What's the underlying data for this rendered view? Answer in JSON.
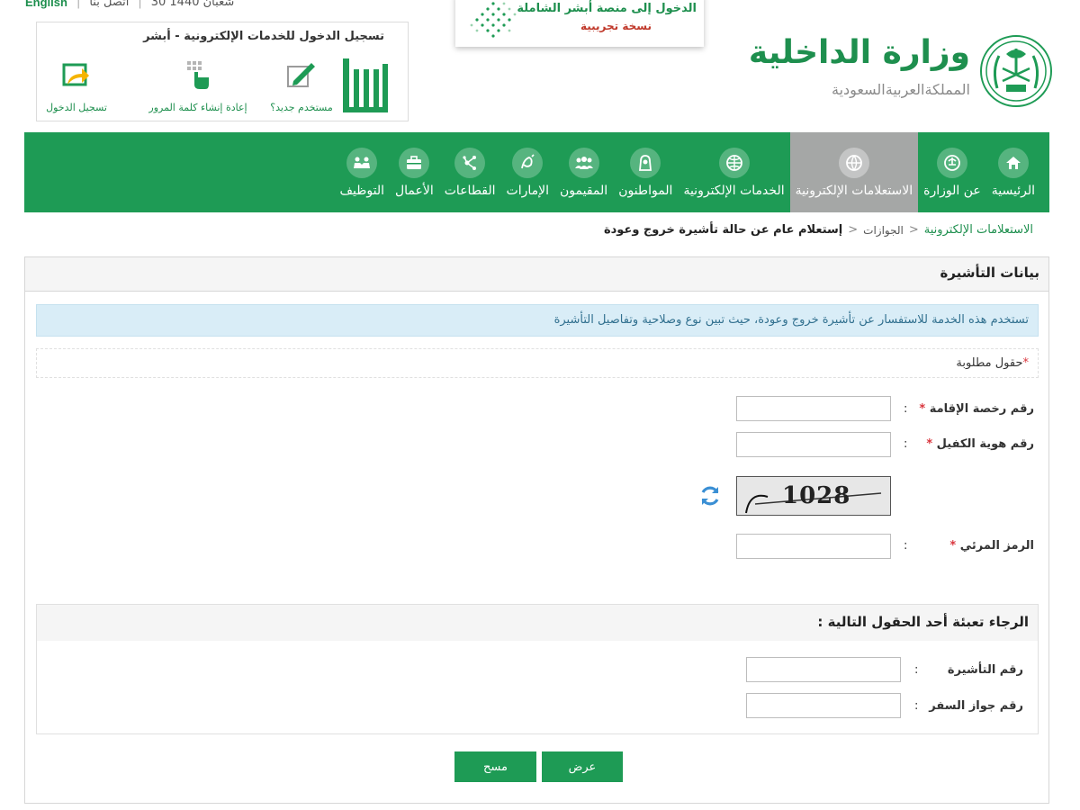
{
  "top_links": {
    "english": "English",
    "contact": "اتصل بنا",
    "date": "30 شعبان 1440"
  },
  "absher": {
    "title": "تسجيل الدخول للخدمات الإلكترونية - أبشر",
    "logo_text": "أبشر",
    "actions": [
      {
        "label": "مستخدم جديد؟",
        "icon": "new-user-icon"
      },
      {
        "label": "إعادة إنشاء كلمة المرور",
        "icon": "reset-password-icon"
      },
      {
        "label": "تسجيل الدخول",
        "icon": "login-icon"
      }
    ]
  },
  "trial_banner": {
    "line1": "الدخول إلى منصة أبشر الشاملة",
    "line2": "نسخة تجريبية"
  },
  "ministry": {
    "name": "وزارة الداخلية",
    "country": "المملكةالعربيةالسعودية"
  },
  "nav": {
    "items": [
      {
        "label": "الرئيسية",
        "icon": "home-icon"
      },
      {
        "label": "عن الوزارة",
        "icon": "emblem-icon"
      },
      {
        "label": "الاستعلامات الإلكترونية",
        "icon": "globe-search-icon",
        "active": true
      },
      {
        "label": "الخدمات الإلكترونية",
        "icon": "globe-icon"
      },
      {
        "label": "المواطنون",
        "icon": "citizen-icon"
      },
      {
        "label": "المقيمون",
        "icon": "residents-icon"
      },
      {
        "label": "الإمارات",
        "icon": "emirates-icon"
      },
      {
        "label": "القطاعات",
        "icon": "sectors-icon"
      },
      {
        "label": "الأعمال",
        "icon": "briefcase-icon"
      },
      {
        "label": "التوظيف",
        "icon": "employment-icon"
      }
    ]
  },
  "breadcrumb": {
    "items": [
      "الاستعلامات الإلكترونية",
      "الجوازات",
      "إستعلام عام عن حالة تأشيرة خروج وعودة"
    ]
  },
  "panel": {
    "title": "بيانات التأشيرة",
    "info": "تستخدم هذه الخدمة للاستفسار عن تأشيرة خروج وعودة، حيث تبين نوع وصلاحية وتفاصيل التأشيرة",
    "required_note": "حقول مطلوبة",
    "required_star": "*",
    "fields": {
      "iqama_label": "رقم رخصة الإقامة",
      "sponsor_label": "رقم هوية الكفيل",
      "captcha_label": "الرمز المرئي",
      "colon": ":",
      "star": "*"
    },
    "captcha_code": "1028",
    "either_title": "الرجاء تعبئة أحد الحقول التالية :",
    "visa_label": "رقم التأشيرة",
    "passport_label": "رقم جواز السفر"
  },
  "buttons": {
    "show": "عرض",
    "clear": "مسح"
  },
  "colors": {
    "brand_green": "#1e9b55",
    "nav_active": "#a5a7a6",
    "info_bg": "#d9edf7",
    "required_star": "#d9363e"
  }
}
